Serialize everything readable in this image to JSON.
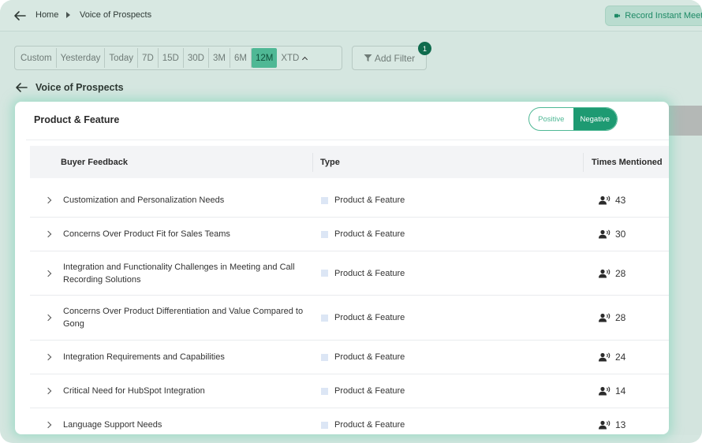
{
  "breadcrumb": {
    "home": "Home",
    "current": "Voice of Prospects"
  },
  "header": {
    "record_label": "Record Instant Meeting"
  },
  "date_filter": {
    "options": [
      "Custom",
      "Yesterday",
      "Today",
      "7D",
      "15D",
      "30D",
      "3M",
      "6M",
      "12M",
      "XTD"
    ],
    "selected": "12M"
  },
  "add_filter": {
    "label": "Add Filter",
    "badge_count": "1"
  },
  "section": {
    "title": "Voice of Prospects"
  },
  "card": {
    "title": "Product & Feature",
    "toggle": {
      "positive": "Positive",
      "negative": "Negative",
      "selected": "Negative"
    }
  },
  "table": {
    "columns": [
      "Buyer Feedback",
      "Type",
      "Times Mentioned"
    ],
    "rows": [
      {
        "feedback": "Customization and Personalization Needs",
        "type": "Product & Feature",
        "times": "43"
      },
      {
        "feedback": "Concerns Over Product Fit for Sales Teams",
        "type": "Product & Feature",
        "times": "30"
      },
      {
        "feedback": "Integration and Functionality Challenges in Meeting and Call Recording Solutions",
        "type": "Product & Feature",
        "times": "28"
      },
      {
        "feedback": "Concerns Over Product Differentiation and Value Compared to Gong",
        "type": "Product & Feature",
        "times": "28"
      },
      {
        "feedback": "Integration Requirements and Capabilities",
        "type": "Product & Feature",
        "times": "24"
      },
      {
        "feedback": "Critical Need for HubSpot Integration",
        "type": "Product & Feature",
        "times": "14"
      },
      {
        "feedback": "Language Support Needs",
        "type": "Product & Feature",
        "times": "13"
      }
    ]
  },
  "colors": {
    "accent": "#1d9a72",
    "accent_light": "#4fb895",
    "backdrop": "#d5e6e0"
  }
}
